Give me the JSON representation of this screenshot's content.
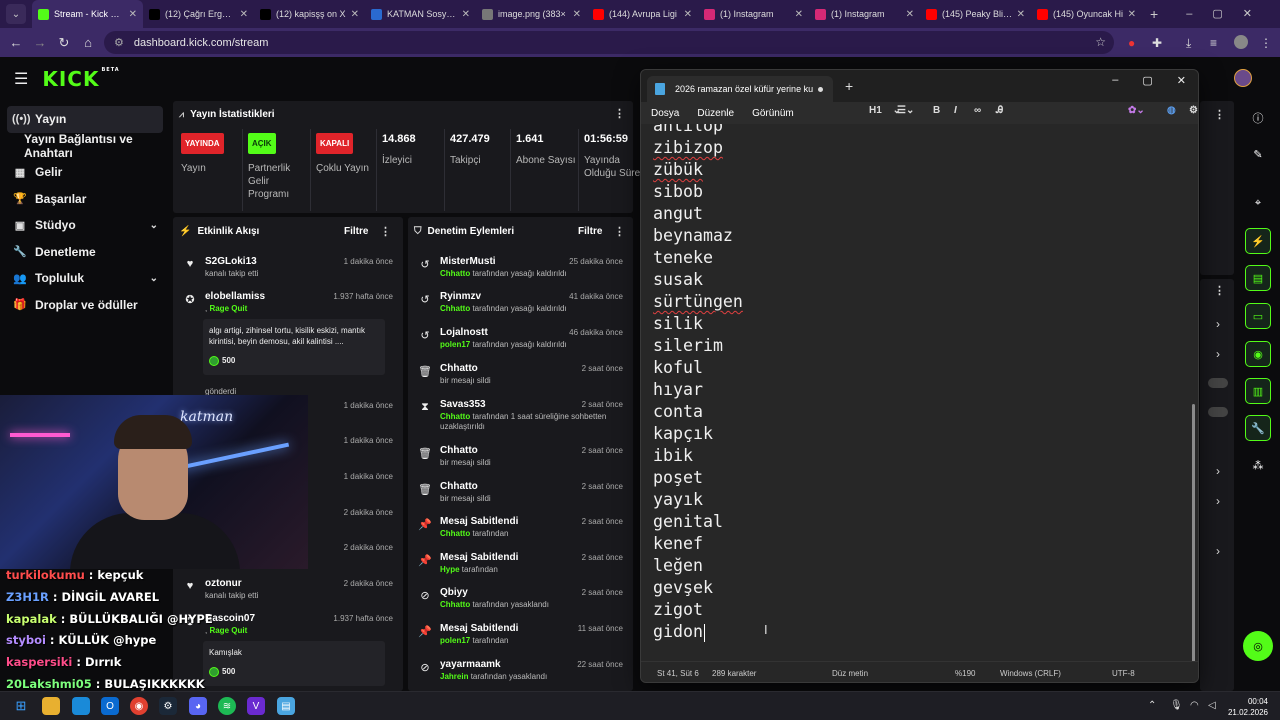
{
  "browser": {
    "tabs": [
      {
        "label": "Stream - Kick Dashboard",
        "color": "#53fc18",
        "active": true
      },
      {
        "label": "(12) Çağrı Ergün on X",
        "color": "#000000"
      },
      {
        "label": "(12) kapisşş on X",
        "color": "#000000"
      },
      {
        "label": "KATMAN Sosyal S",
        "color": "#2a6ad0"
      },
      {
        "label": "image.png (383×",
        "color": "#777777"
      },
      {
        "label": "(144) Avrupa Ligi",
        "color": "#ff0000"
      },
      {
        "label": "(1) Instagram",
        "color": "#d62976"
      },
      {
        "label": "(1) Instagram",
        "color": "#d62976"
      },
      {
        "label": "(145) Peaky Blinders",
        "color": "#ff0000"
      },
      {
        "label": "(145) Oyuncak Hi",
        "color": "#ff0000"
      }
    ],
    "url": "dashboard.kick.com/stream"
  },
  "kick": {
    "logo": "KICK",
    "logo_beta": "BETA",
    "sidebar": [
      {
        "label": "Yayın",
        "icon": "broadcast-icon",
        "glyph": "((•))",
        "active": true
      },
      {
        "label": "Yayın Bağlantısı ve Anahtarı",
        "icon": "",
        "glyph": "",
        "sub": true
      },
      {
        "label": "Gelir",
        "icon": "revenue-icon",
        "glyph": "▦"
      },
      {
        "label": "Başarılar",
        "icon": "trophy-icon",
        "glyph": "🏆"
      },
      {
        "label": "Stüdyo",
        "icon": "studio-icon",
        "glyph": "▣",
        "chevron": true
      },
      {
        "label": "Denetleme",
        "icon": "wrench-icon",
        "glyph": "🔧"
      },
      {
        "label": "Topluluk",
        "icon": "community-icon",
        "glyph": "👥",
        "chevron": true
      },
      {
        "label": "Droplar ve ödüller",
        "icon": "gift-icon",
        "glyph": "🎁"
      }
    ],
    "stats": {
      "title": "Yayın İstatistikleri",
      "status": [
        {
          "badge": "YAYINDA",
          "badge_color": "#e0242a",
          "label": "Yayın"
        },
        {
          "badge": "AÇIK",
          "badge_color": "#53fc18",
          "label": "Partnerlik Gelir Programı"
        },
        {
          "badge": "KAPALI",
          "badge_color": "#e0242a",
          "label": "Çoklu Yayın"
        }
      ],
      "numbers": [
        {
          "value": "14.868",
          "label": "İzleyici"
        },
        {
          "value": "427.479",
          "label": "Takipçi"
        },
        {
          "value": "1.641",
          "label": "Abone Sayısı"
        },
        {
          "value": "01:56:59",
          "label": "Yayında Olduğu Süre"
        }
      ]
    },
    "activity": {
      "title": "Etkinlik Akışı",
      "filter": "Filtre",
      "items": [
        {
          "name": "S2GLoki13",
          "sub": "kanalı takip etti",
          "time": "1 dakika önce",
          "icon": "heart-icon",
          "glyph": "♥"
        },
        {
          "name": "elobellamiss",
          "sub_green": "Rage Quit",
          "time": "1.937 hafta önce",
          "icon": "kick-coin-icon",
          "glyph": "✪",
          "quote": "algı artigi, zihinsel tortu, kisilik eskizi, mantık kirintisi, beyin demosu, akil kalintisi ....",
          "coins": "500",
          "after": "gönderdi"
        },
        {
          "time": "1 dakika önce"
        },
        {
          "time": "1 dakika önce"
        },
        {
          "time": "1 dakika önce"
        },
        {
          "time": "2 dakika önce"
        },
        {
          "time": "2 dakika önce"
        },
        {
          "name": "oztonur",
          "sub": "kanalı takip etti",
          "time": "2 dakika önce",
          "icon": "heart-icon",
          "glyph": "♥"
        },
        {
          "name": "Rascoin07",
          "sub_green": "Rage Quit",
          "time": "1.937 hafta önce",
          "icon": "kick-coin-icon",
          "glyph": "✪",
          "quote": "Kamışlak",
          "coins": "500"
        }
      ]
    },
    "moderation": {
      "title": "Denetim Eylemleri",
      "filter": "Filtre",
      "items": [
        {
          "name": "MisterMusti",
          "who": "Chhatto",
          "rest": "tarafından yasağı kaldırıldı",
          "time": "25 dakika önce",
          "icon": "undo-icon",
          "glyph": "↺"
        },
        {
          "name": "Ryinmzv",
          "who": "Chhatto",
          "rest": "tarafından yasağı kaldırıldı",
          "time": "41 dakika önce",
          "icon": "undo-icon",
          "glyph": "↺"
        },
        {
          "name": "Lojalnostt",
          "who": "polen17",
          "rest": "tarafından yasağı kaldırıldı",
          "time": "46 dakika önce",
          "icon": "undo-icon",
          "glyph": "↺"
        },
        {
          "name": "Chhatto",
          "plain": "bir mesajı sildi",
          "time": "2 saat önce",
          "icon": "trash-icon",
          "glyph": "🗑"
        },
        {
          "name": "Savas353",
          "who": "Chhatto",
          "rest": "tarafından 1 saat süreliğine sohbetten uzaklaştırıldı",
          "time": "2 saat önce",
          "icon": "hourglass-icon",
          "glyph": "⧗"
        },
        {
          "name": "Chhatto",
          "plain": "bir mesajı sildi",
          "time": "2 saat önce",
          "icon": "trash-icon",
          "glyph": "🗑"
        },
        {
          "name": "Chhatto",
          "plain": "bir mesajı sildi",
          "time": "2 saat önce",
          "icon": "trash-icon",
          "glyph": "🗑"
        },
        {
          "name": "Mesaj Sabitlendi",
          "who": "Chhatto",
          "rest": "tarafından",
          "time": "2 saat önce",
          "icon": "pin-icon",
          "glyph": "📌"
        },
        {
          "name": "Mesaj Sabitlendi",
          "who": "Hype",
          "rest": "tarafından",
          "time": "2 saat önce",
          "icon": "pin-icon",
          "glyph": "📌"
        },
        {
          "name": "Qbiyy",
          "who": "Chhatto",
          "rest": "tarafından yasaklandı",
          "time": "2 saat önce",
          "icon": "ban-icon",
          "glyph": "⊘"
        },
        {
          "name": "Mesaj Sabitlendi",
          "who": "polen17",
          "rest": "tarafından",
          "time": "11 saat önce",
          "icon": "pin-icon",
          "glyph": "📌"
        },
        {
          "name": "yayarmaamk",
          "who": "Jahrein",
          "rest": "tarafından yasaklandı",
          "time": "22 saat önce",
          "icon": "ban-icon",
          "glyph": "⊘"
        }
      ]
    }
  },
  "webcam": {
    "neon": "katman"
  },
  "chat": [
    {
      "user": "turkilokumu",
      "color": "#ff4d4d",
      "msg": "kepçuk"
    },
    {
      "user": "Z3H1R",
      "color": "#6aa0ff",
      "msg": "DİNGİL AVAREL"
    },
    {
      "user": "kapalak",
      "color": "#c8ff70",
      "msg": "BÜLLÜKBALIĞI @HYPE"
    },
    {
      "user": "styboi",
      "color": "#b48cff",
      "msg": "KÜLLÜK @hype"
    },
    {
      "user": "kaspersiki",
      "color": "#ff4d8a",
      "msg": "Dırrık"
    },
    {
      "user": "20Lakshmi05",
      "color": "#7dff7d",
      "msg": "BULAŞIKKKKKK"
    }
  ],
  "notepad": {
    "tab_title": "2026 ramazan özel küfür yerine kul",
    "menu": [
      "Dosya",
      "Düzenle",
      "Görünüm"
    ],
    "heading": "H1",
    "lines": [
      {
        "text": "antilop",
        "err": false
      },
      {
        "text": "zibizop",
        "err": true
      },
      {
        "text": "zübük",
        "err": true
      },
      {
        "text": "sibob",
        "err": false
      },
      {
        "text": "angut",
        "err": false
      },
      {
        "text": "beynamaz",
        "err": false
      },
      {
        "text": "teneke",
        "err": false
      },
      {
        "text": "susak",
        "err": false
      },
      {
        "text": "sürtüngen",
        "err": true
      },
      {
        "text": "silik",
        "err": false
      },
      {
        "text": "silerim",
        "err": false
      },
      {
        "text": "koful",
        "err": false
      },
      {
        "text": "hıyar",
        "err": false
      },
      {
        "text": "conta",
        "err": false
      },
      {
        "text": "kapçık",
        "err": false
      },
      {
        "text": "ibik",
        "err": false
      },
      {
        "text": "poşet",
        "err": false
      },
      {
        "text": "yayık",
        "err": false
      },
      {
        "text": "genital",
        "err": false
      },
      {
        "text": "kenef",
        "err": false
      },
      {
        "text": "leğen",
        "err": false
      },
      {
        "text": "gevşek",
        "err": false
      },
      {
        "text": "zigot",
        "err": false
      },
      {
        "text": "gidon",
        "err": false
      }
    ],
    "status": {
      "pos": "St 41, Süt 6",
      "chars": "289 karakter",
      "mode": "Düz metin",
      "zoom": "%190",
      "eol": "Windows (CRLF)",
      "enc": "UTF-8"
    }
  },
  "taskbar": {
    "time": "00:04",
    "date": "21.02.2026"
  }
}
